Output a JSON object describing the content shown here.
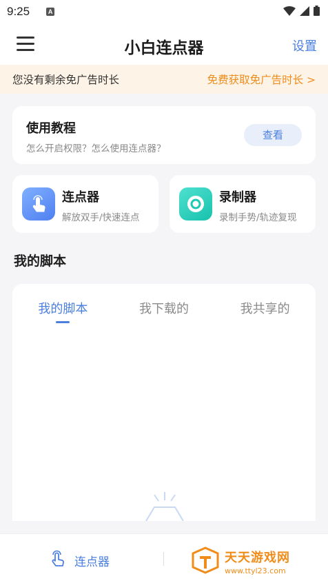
{
  "status_bar": {
    "time": "9:25",
    "notification_badge": "A",
    "icons": [
      "wifi-icon",
      "cellular-signal-icon",
      "battery-icon"
    ]
  },
  "app_bar": {
    "title": "小白连点器",
    "settings_label": "设置",
    "menu_icon": "hamburger-menu-icon"
  },
  "ad_banner": {
    "message": "您没有剩余免广告时长",
    "cta": "免费获取免广告时长 >"
  },
  "tutorial": {
    "title": "使用教程",
    "subtitle": "怎么开启权限？怎么使用连点器？",
    "button_label": "查看"
  },
  "features": [
    {
      "title": "连点器",
      "subtitle": "解放双手/快速连点",
      "icon": "tap-hand-icon"
    },
    {
      "title": "录制器",
      "subtitle": "录制手势/轨迹复现",
      "icon": "record-icon"
    }
  ],
  "scripts_section": {
    "title": "我的脚本",
    "tabs": [
      {
        "label": "我的脚本",
        "active": true
      },
      {
        "label": "我下载的",
        "active": false
      },
      {
        "label": "我共享的",
        "active": false
      }
    ]
  },
  "bottom_nav": {
    "clicker_label": "连点器"
  },
  "watermark": {
    "name": "天天游戏网",
    "url": "www.ttyl23.com"
  },
  "colors": {
    "accent": "#4a7fe0",
    "orange": "#f08c1a",
    "banner_bg": "#fdf3e6",
    "page_bg": "#f5f5f7"
  }
}
